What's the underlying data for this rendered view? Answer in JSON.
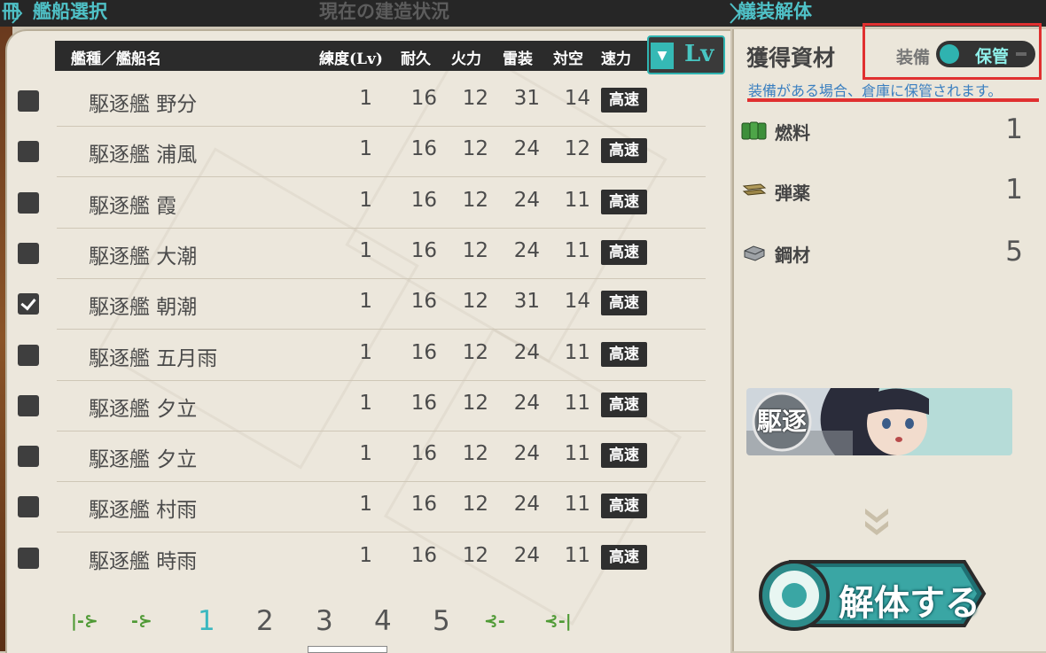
{
  "header": {
    "left_title": "艦船選択",
    "left_prefix": "冊",
    "center_title": "現在の建造状況",
    "right_title": "艤装解体"
  },
  "table": {
    "columns": [
      "艦種／艦船名",
      "練度(Lv)",
      "耐久",
      "火力",
      "雷装",
      "対空",
      "速力"
    ],
    "sort_label": "Lv",
    "rows": [
      {
        "name": "駆逐艦 野分",
        "lv": "1",
        "hp": "16",
        "fp": "12",
        "tp": "31",
        "aa": "14",
        "speed": "高速",
        "checked": false
      },
      {
        "name": "駆逐艦 浦風",
        "lv": "1",
        "hp": "16",
        "fp": "12",
        "tp": "24",
        "aa": "12",
        "speed": "高速",
        "checked": false
      },
      {
        "name": "駆逐艦 霞",
        "lv": "1",
        "hp": "16",
        "fp": "12",
        "tp": "24",
        "aa": "11",
        "speed": "高速",
        "checked": false
      },
      {
        "name": "駆逐艦 大潮",
        "lv": "1",
        "hp": "16",
        "fp": "12",
        "tp": "24",
        "aa": "11",
        "speed": "高速",
        "checked": false
      },
      {
        "name": "駆逐艦 朝潮",
        "lv": "1",
        "hp": "16",
        "fp": "12",
        "tp": "31",
        "aa": "14",
        "speed": "高速",
        "checked": true
      },
      {
        "name": "駆逐艦 五月雨",
        "lv": "1",
        "hp": "16",
        "fp": "12",
        "tp": "24",
        "aa": "11",
        "speed": "高速",
        "checked": false
      },
      {
        "name": "駆逐艦 夕立",
        "lv": "1",
        "hp": "16",
        "fp": "12",
        "tp": "24",
        "aa": "11",
        "speed": "高速",
        "checked": false
      },
      {
        "name": "駆逐艦 夕立",
        "lv": "1",
        "hp": "16",
        "fp": "12",
        "tp": "24",
        "aa": "11",
        "speed": "高速",
        "checked": false
      },
      {
        "name": "駆逐艦 村雨",
        "lv": "1",
        "hp": "16",
        "fp": "12",
        "tp": "24",
        "aa": "11",
        "speed": "高速",
        "checked": false
      },
      {
        "name": "駆逐艦 時雨",
        "lv": "1",
        "hp": "16",
        "fp": "12",
        "tp": "24",
        "aa": "11",
        "speed": "高速",
        "checked": false
      }
    ]
  },
  "pagination": {
    "first": "|-⊱",
    "prev": "-⊱",
    "pages": [
      "1",
      "2",
      "3",
      "4",
      "5"
    ],
    "current": "1",
    "next": "⊰-",
    "last": "⊰-|"
  },
  "resources": {
    "title": "獲得資材",
    "equip_toggle_label": "装備",
    "equip_toggle_value": "保管",
    "note": "装備がある場合、倉庫に保管されます。",
    "items": [
      {
        "name": "燃料",
        "value": "1",
        "icon": "fuel-icon"
      },
      {
        "name": "弾薬",
        "value": "1",
        "icon": "ammo-icon"
      },
      {
        "name": "鋼材",
        "value": "5",
        "icon": "steel-icon"
      }
    ]
  },
  "ship_card": {
    "type_badge": "駆逐"
  },
  "scrap_button": "解体する",
  "colors": {
    "accent": "#3bb8c0",
    "highlight": "#e03030",
    "dark": "#2b2b2b"
  }
}
